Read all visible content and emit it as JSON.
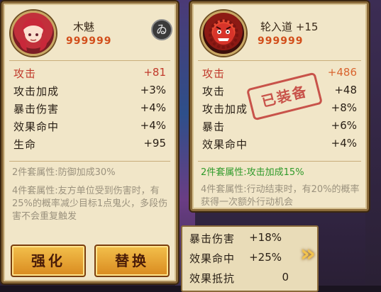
{
  "left_card": {
    "name": "木魅",
    "level_stars": "999999",
    "lock_icon_glyph": "ゐ",
    "stats": [
      {
        "label": "攻击",
        "value": "+81",
        "main": true
      },
      {
        "label": "攻击加成",
        "value": "+3%"
      },
      {
        "label": "暴击伤害",
        "value": "+4%"
      },
      {
        "label": "效果命中",
        "value": "+4%"
      },
      {
        "label": "生命",
        "value": "+95"
      }
    ],
    "bonus2": "2件套属性:防御加成30%",
    "bonus4": "4件套属性:友方单位受到伤害时，有25%的概率减少目标1点鬼火，多段伤害不会重复触发",
    "buttons": {
      "enhance": "强化",
      "replace": "替换"
    }
  },
  "right_card": {
    "name": "轮入道 +15",
    "level_stars": "999999",
    "stamp": "已装备",
    "stats": [
      {
        "label": "攻击",
        "value": "+486",
        "main": true
      },
      {
        "label": "攻击",
        "value": "+48"
      },
      {
        "label": "攻击加成",
        "value": "+8%"
      },
      {
        "label": "暴击",
        "value": "+6%"
      },
      {
        "label": "效果命中",
        "value": "+4%"
      }
    ],
    "bonus2": "2件套属性:攻击加成15%",
    "bonus4": "4件套属性:行动结束时，有20%的概率获得一次额外行动机会"
  },
  "underlying_list": {
    "rows": [
      {
        "label": "暴击伤害",
        "value": "+18%"
      },
      {
        "label": "效果命中",
        "value": "+25%"
      },
      {
        "label": "效果抵抗",
        "value": "0"
      }
    ]
  },
  "arrow_glyph": "»",
  "colors": {
    "main_stat": "#c0392b",
    "active_bonus": "#2f9a2a",
    "inactive_bonus": "#9b927e",
    "stamp": "#c23a35"
  }
}
